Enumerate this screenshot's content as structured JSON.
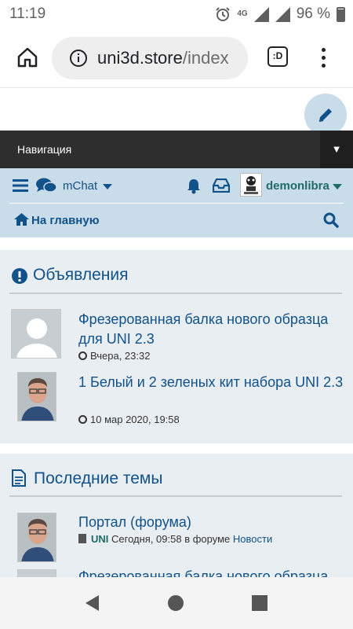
{
  "status": {
    "time": "11:19",
    "network": "4G",
    "battery": "96 %"
  },
  "browser": {
    "url_host": "uni3d.store",
    "url_path": "/index",
    "tabs_label": ":D"
  },
  "nav": {
    "label": "Навигация",
    "toggle": "▼"
  },
  "header": {
    "mchat": "mChat",
    "username": "demonlibra",
    "home": "На главную"
  },
  "announcements": {
    "title": "Объявления",
    "items": [
      {
        "title": "Фрезерованная балка нового образца для UNI 2.3",
        "time": "Вчера, 23:32",
        "avatar": "placeholder-avatar"
      },
      {
        "title": "1 Белый и 2 зеленых кит набора UNI 2.3",
        "time": "10 мар 2020, 19:58",
        "avatar": "user-photo-avatar"
      }
    ]
  },
  "latest": {
    "title": "Последние темы",
    "items": [
      {
        "title": "Портал (форума)",
        "author": "UNI",
        "time": "Сегодня, 09:58",
        "in_forum": "в форуме",
        "forum": "Новости",
        "avatar": "user-photo-avatar"
      },
      {
        "title": "Фрезерованная балка нового образца",
        "avatar": "placeholder-avatar"
      }
    ]
  },
  "colors": {
    "link": "#105289",
    "header_bg": "#c9dce9",
    "panel_bg": "#e9eef2",
    "navbar_bg": "#2e2e2e",
    "username": "#1f6b68"
  }
}
